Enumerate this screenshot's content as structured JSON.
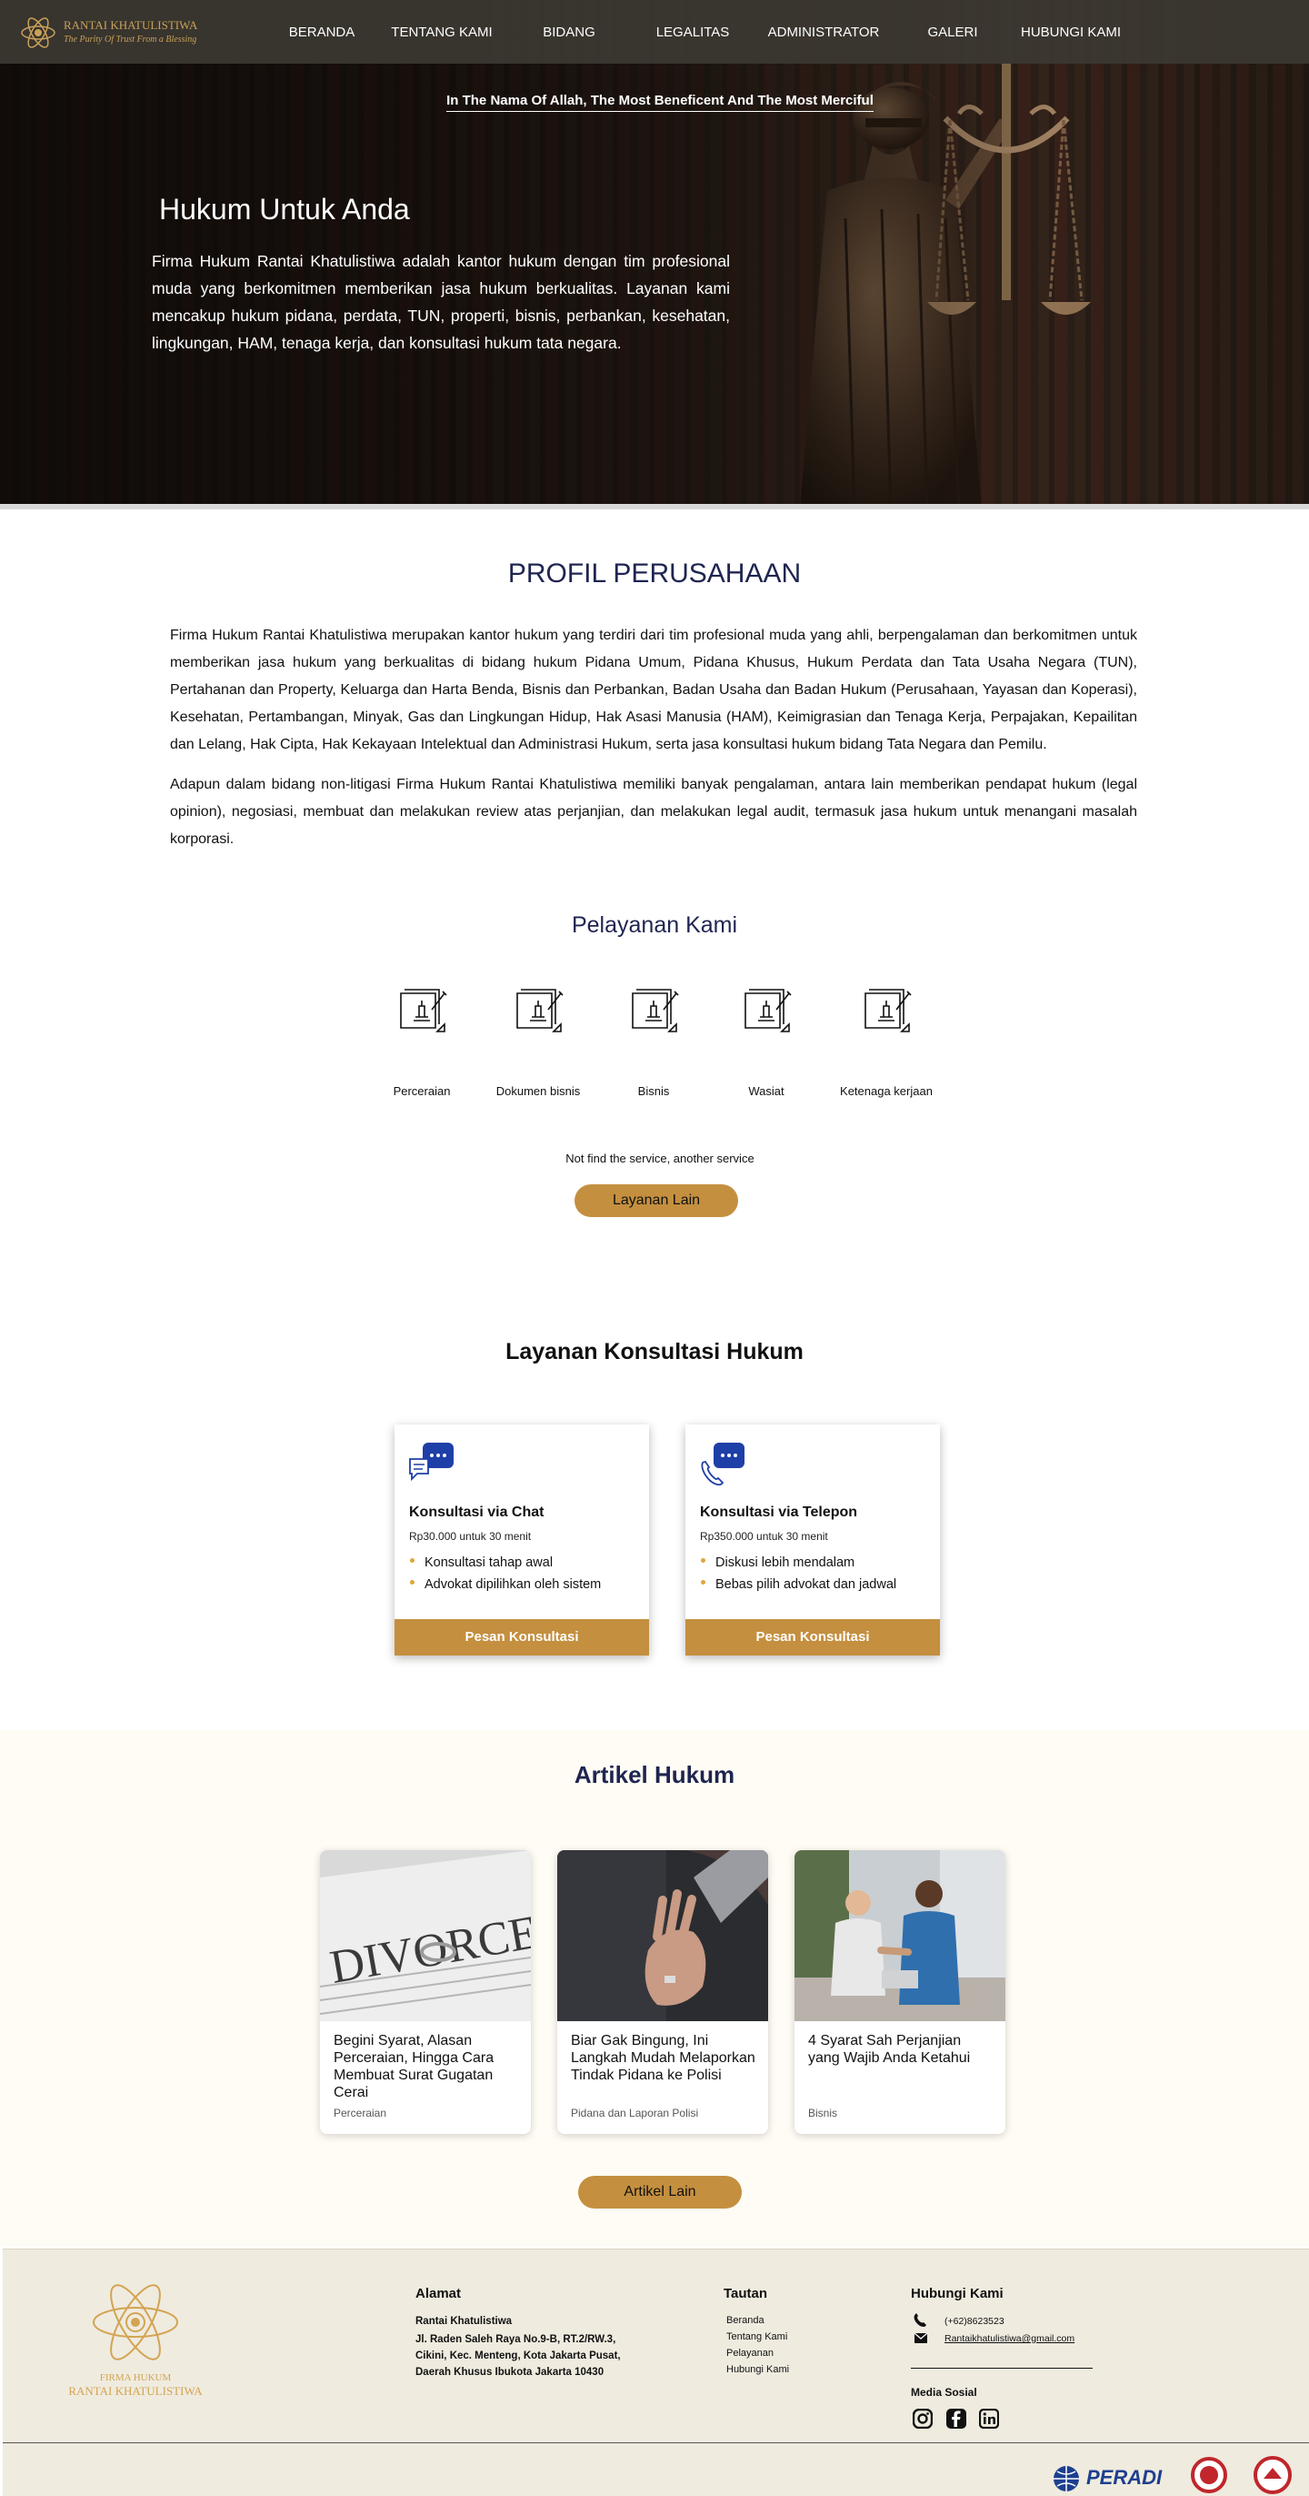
{
  "nav": {
    "logo_name": "RANTAI KHATULISTIWA",
    "logo_tagline": "The Purity Of Trust From a Blessing",
    "items": [
      "BERANDA",
      "TENTANG KAMI",
      "BIDANG",
      "LEGALITAS",
      "ADMINISTRATOR",
      "GALERI",
      "HUBUNGI KAMI"
    ]
  },
  "hero": {
    "bismillah": "In The Nama Of Allah, The Most Beneficent And The Most Merciful",
    "title": "Hukum Untuk Anda",
    "text": "Firma Hukum Rantai Khatulistiwa adalah kantor hukum dengan tim profesional muda yang berkomitmen memberikan jasa hukum berkualitas. Layanan kami mencakup hukum pidana, perdata, TUN, properti, bisnis, perbankan, kesehatan, lingkungan, HAM, tenaga kerja, dan konsultasi hukum tata negara."
  },
  "profil": {
    "title": "PROFIL PERUSAHAAN",
    "para1": "Firma Hukum Rantai Khatulistiwa merupakan kantor hukum yang  terdiri dari tim profesional muda yang ahli, berpengalaman dan berkomitmen untuk memberikan jasa hukum yang berkualitas di bidang hukum Pidana Umum, Pidana Khusus, Hukum Perdata dan Tata Usaha Negara (TUN), Pertahanan dan Property, Keluarga dan Harta Benda, Bisnis dan Perbankan, Badan Usaha dan Badan Hukum (Perusahaan, Yayasan dan Koperasi), Kesehatan, Pertambangan, Minyak, Gas dan Lingkungan Hidup, Hak Asasi Manusia (HAM), Keimigrasian dan Tenaga Kerja, Perpajakan, Kepailitan dan Lelang, Hak Cipta, Hak Kekayaan Intelektual dan Administrasi Hukum, serta jasa konsultasi hukum bidang Tata Negara dan Pemilu.",
    "para2": "Adapun dalam bidang non-litigasi Firma Hukum Rantai Khatulistiwa memiliki banyak pengalaman, antara lain memberikan pendapat hukum (legal opinion), negosiasi, membuat dan melakukan review atas perjanjian, dan melakukan legal audit, termasuk jasa hukum untuk menangani masalah korporasi."
  },
  "pelayanan": {
    "title": "Pelayanan Kami",
    "services": [
      "Perceraian",
      "Dokumen bisnis",
      "Bisnis",
      "Wasiat",
      "Ketenaga kerjaan"
    ],
    "note": "Not find the service, another service",
    "button": "Layanan Lain"
  },
  "konsultasi": {
    "title": "Layanan Konsultasi Hukum",
    "cards": [
      {
        "title": "Konsultasi via Chat",
        "price": "Rp30.000 untuk 30 menit",
        "features": [
          "Konsultasi tahap awal",
          "Advokat dipilihkan oleh sistem"
        ],
        "button": "Pesan Konsultasi",
        "icon": "chat-bubble-icon"
      },
      {
        "title": "Konsultasi via Telepon",
        "price": "Rp350.000 untuk 30 menit",
        "features": [
          "Diskusi lebih mendalam",
          "Bebas pilih advokat dan jadwal"
        ],
        "button": "Pesan Konsultasi",
        "icon": "phone-bubble-icon"
      }
    ]
  },
  "artikel": {
    "title": "Artikel Hukum",
    "items": [
      {
        "title": "Begini Syarat, Alasan Perceraian, Hingga Cara Membuat Surat Gugatan Cerai",
        "category": "Perceraian"
      },
      {
        "title": "Biar Gak Bingung, Ini Langkah Mudah Melaporkan Tindak Pidana ke Polisi",
        "category": "Pidana dan Laporan Polisi"
      },
      {
        "title": "4 Syarat Sah Perjanjian yang Wajib Anda Ketahui",
        "category": "Bisnis"
      }
    ],
    "button": "Artikel Lain"
  },
  "footer": {
    "logo_line1": "FIRMA HUKUM",
    "logo_line2": "RANTAI KHATULISTIWA",
    "alamat_title": "Alamat",
    "alamat_name": "Rantai Khatulistiwa",
    "alamat_lines": [
      "Jl. Raden Saleh Raya No.9-B, RT.2/RW.3,",
      "Cikini, Kec. Menteng, Kota Jakarta Pusat,",
      "Daerah Khusus Ibukota Jakarta 10430"
    ],
    "tautan_title": "Tautan",
    "tautan": [
      "Beranda",
      "Tentang Kami",
      "Pelayanan",
      "Hubungi Kami"
    ],
    "hubungi_title": "Hubungi Kami",
    "phone": "(+62)8623523",
    "email": "Rantaikhatulistiwa@gmail.com",
    "media_title": "Media Sosial",
    "peradi": "PERADI"
  },
  "colors": {
    "gold": "#c48f3f",
    "navy": "#1f2550",
    "chat_blue": "#1f3fa8"
  }
}
